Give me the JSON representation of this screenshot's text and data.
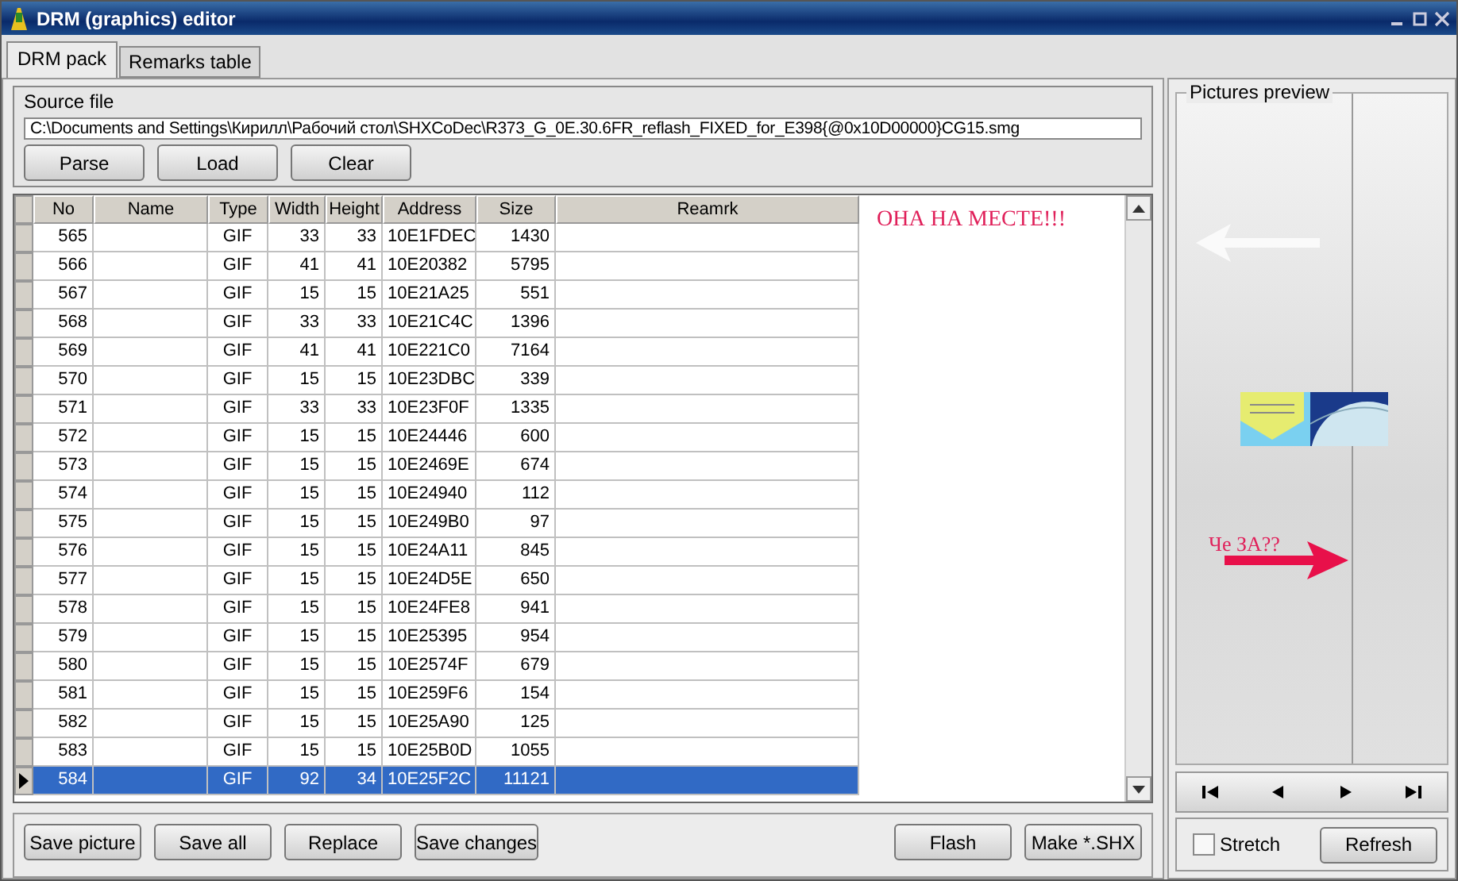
{
  "window": {
    "title": "DRM (graphics) editor"
  },
  "tabs": [
    {
      "label": "DRM pack",
      "selected": true
    },
    {
      "label": "Remarks table",
      "selected": false
    }
  ],
  "source_file": {
    "label": "Source file",
    "value": "C:\\Documents and Settings\\Кирилл\\Рабочий стол\\SHXCoDec\\R373_G_0E.30.6FR_reflash_FIXED_for_E398{@0x10D00000}CG15.smg"
  },
  "source_buttons": [
    "Parse",
    "Load",
    "Clear"
  ],
  "table": {
    "columns": [
      "No",
      "Name",
      "Type",
      "Width",
      "Height",
      "Address",
      "Size",
      "Reamrk"
    ],
    "rows": [
      {
        "cells": [
          "565",
          "",
          "GIF",
          "33",
          "33",
          "10E1FDEC",
          "1430",
          ""
        ],
        "selected": false
      },
      {
        "cells": [
          "566",
          "",
          "GIF",
          "41",
          "41",
          "10E20382",
          "5795",
          ""
        ],
        "selected": false
      },
      {
        "cells": [
          "567",
          "",
          "GIF",
          "15",
          "15",
          "10E21A25",
          "551",
          ""
        ],
        "selected": false
      },
      {
        "cells": [
          "568",
          "",
          "GIF",
          "33",
          "33",
          "10E21C4C",
          "1396",
          ""
        ],
        "selected": false
      },
      {
        "cells": [
          "569",
          "",
          "GIF",
          "41",
          "41",
          "10E221C0",
          "7164",
          ""
        ],
        "selected": false
      },
      {
        "cells": [
          "570",
          "",
          "GIF",
          "15",
          "15",
          "10E23DBC",
          "339",
          ""
        ],
        "selected": false
      },
      {
        "cells": [
          "571",
          "",
          "GIF",
          "33",
          "33",
          "10E23F0F",
          "1335",
          ""
        ],
        "selected": false
      },
      {
        "cells": [
          "572",
          "",
          "GIF",
          "15",
          "15",
          "10E24446",
          "600",
          ""
        ],
        "selected": false
      },
      {
        "cells": [
          "573",
          "",
          "GIF",
          "15",
          "15",
          "10E2469E",
          "674",
          ""
        ],
        "selected": false
      },
      {
        "cells": [
          "574",
          "",
          "GIF",
          "15",
          "15",
          "10E24940",
          "112",
          ""
        ],
        "selected": false
      },
      {
        "cells": [
          "575",
          "",
          "GIF",
          "15",
          "15",
          "10E249B0",
          "97",
          ""
        ],
        "selected": false
      },
      {
        "cells": [
          "576",
          "",
          "GIF",
          "15",
          "15",
          "10E24A11",
          "845",
          ""
        ],
        "selected": false
      },
      {
        "cells": [
          "577",
          "",
          "GIF",
          "15",
          "15",
          "10E24D5E",
          "650",
          ""
        ],
        "selected": false
      },
      {
        "cells": [
          "578",
          "",
          "GIF",
          "15",
          "15",
          "10E24FE8",
          "941",
          ""
        ],
        "selected": false
      },
      {
        "cells": [
          "579",
          "",
          "GIF",
          "15",
          "15",
          "10E25395",
          "954",
          ""
        ],
        "selected": false
      },
      {
        "cells": [
          "580",
          "",
          "GIF",
          "15",
          "15",
          "10E2574F",
          "679",
          ""
        ],
        "selected": false
      },
      {
        "cells": [
          "581",
          "",
          "GIF",
          "15",
          "15",
          "10E259F6",
          "154",
          ""
        ],
        "selected": false
      },
      {
        "cells": [
          "582",
          "",
          "GIF",
          "15",
          "15",
          "10E25A90",
          "125",
          ""
        ],
        "selected": false
      },
      {
        "cells": [
          "583",
          "",
          "GIF",
          "15",
          "15",
          "10E25B0D",
          "1055",
          ""
        ],
        "selected": false
      },
      {
        "cells": [
          "584",
          "",
          "GIF",
          "92",
          "34",
          "10E25F2C",
          "11121",
          ""
        ],
        "selected": true
      }
    ]
  },
  "memo": {
    "annotation": "ОНА НА МЕСТЕ!!!"
  },
  "bottom_buttons_left": [
    "Save picture",
    "Save all",
    "Replace",
    "Save changes"
  ],
  "bottom_buttons_right": [
    "Flash",
    "Make *.SHX"
  ],
  "preview": {
    "title": "Pictures preview",
    "annotation": "Че ЗА??"
  },
  "stretch": {
    "label": "Stretch",
    "checked": false
  },
  "refresh_button": "Refresh"
}
